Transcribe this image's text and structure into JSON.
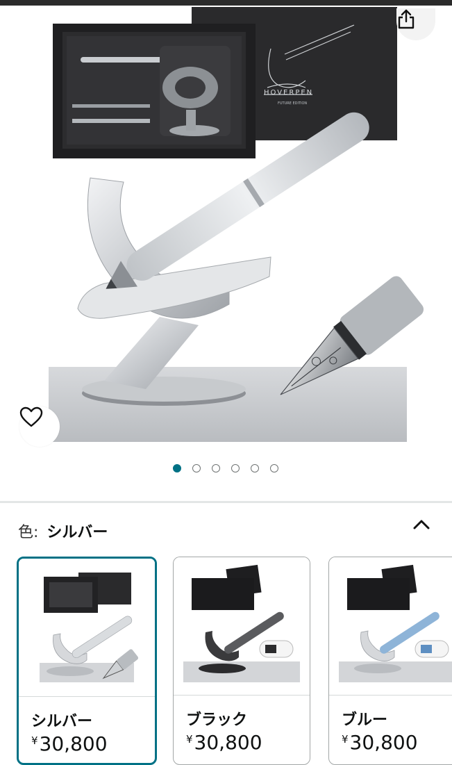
{
  "hero": {
    "brand_text": "HOVERPEN",
    "edition_text": "FUTURE EDITION",
    "share_icon": "share-icon",
    "wishlist_icon": "heart-outline-icon"
  },
  "carousel": {
    "count": 6,
    "active_index": 0
  },
  "variation": {
    "label": "色:",
    "selected_value": "シルバー",
    "collapse_icon": "chevron-up-icon"
  },
  "colors": {
    "accent": "#007185",
    "border": "#a2a6a6",
    "divider": "#e3e6e6"
  },
  "options": [
    {
      "name": "シルバー",
      "currency": "¥",
      "price": "30,800",
      "selected": true,
      "pen_color": "#d9dcdf"
    },
    {
      "name": "ブラック",
      "currency": "¥",
      "price": "30,800",
      "selected": false,
      "pen_color": "#3a3a3a"
    },
    {
      "name": "ブルー",
      "currency": "¥",
      "price": "30,800",
      "selected": false,
      "pen_color": "#8eb4d8"
    }
  ]
}
